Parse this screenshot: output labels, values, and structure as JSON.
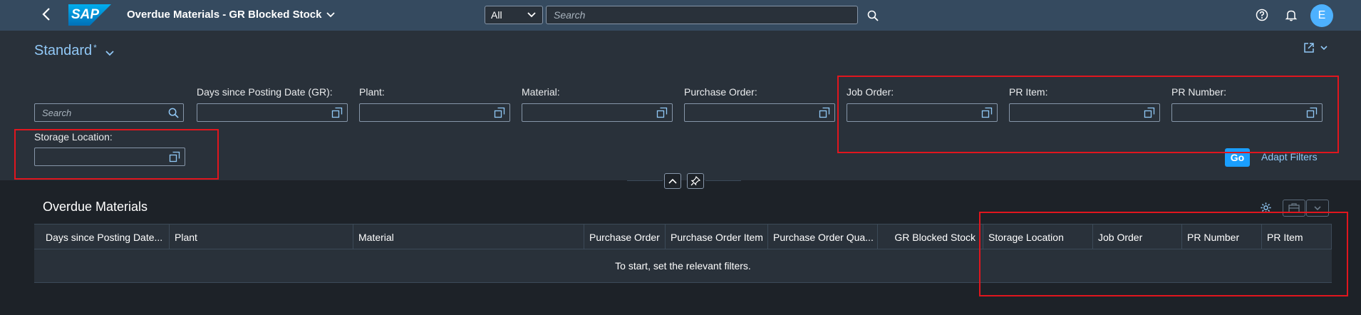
{
  "shell": {
    "app_title": "Overdue Materials - GR Blocked Stock",
    "logo_text": "SAP",
    "scope": "All",
    "search_placeholder": "Search",
    "avatar_initial": "E"
  },
  "variant": {
    "name": "Standard",
    "modified_marker": "*"
  },
  "filters": {
    "search_placeholder": "Search",
    "fields": [
      {
        "label": "Days since Posting Date (GR):"
      },
      {
        "label": "Plant:"
      },
      {
        "label": "Material:"
      },
      {
        "label": "Purchase Order:"
      },
      {
        "label": "Job Order:"
      },
      {
        "label": "PR Item:"
      },
      {
        "label": "PR Number:"
      },
      {
        "label": "Storage Location:"
      }
    ],
    "go_label": "Go",
    "adapt_label": "Adapt Filters"
  },
  "table": {
    "title": "Overdue Materials",
    "columns": [
      "Days since Posting Date...",
      "Plant",
      "Material",
      "Purchase Order",
      "Purchase Order Item",
      "Purchase Order Qua...",
      "GR Blocked Stock",
      "Storage Location",
      "Job Order",
      "PR Number",
      "PR Item"
    ],
    "empty_text": "To start, set the relevant filters."
  },
  "colors": {
    "shell": "#354a5f",
    "background": "#29313a",
    "accent": "#1a9fff",
    "link": "#91c8f6",
    "highlight": "#e0161e"
  }
}
